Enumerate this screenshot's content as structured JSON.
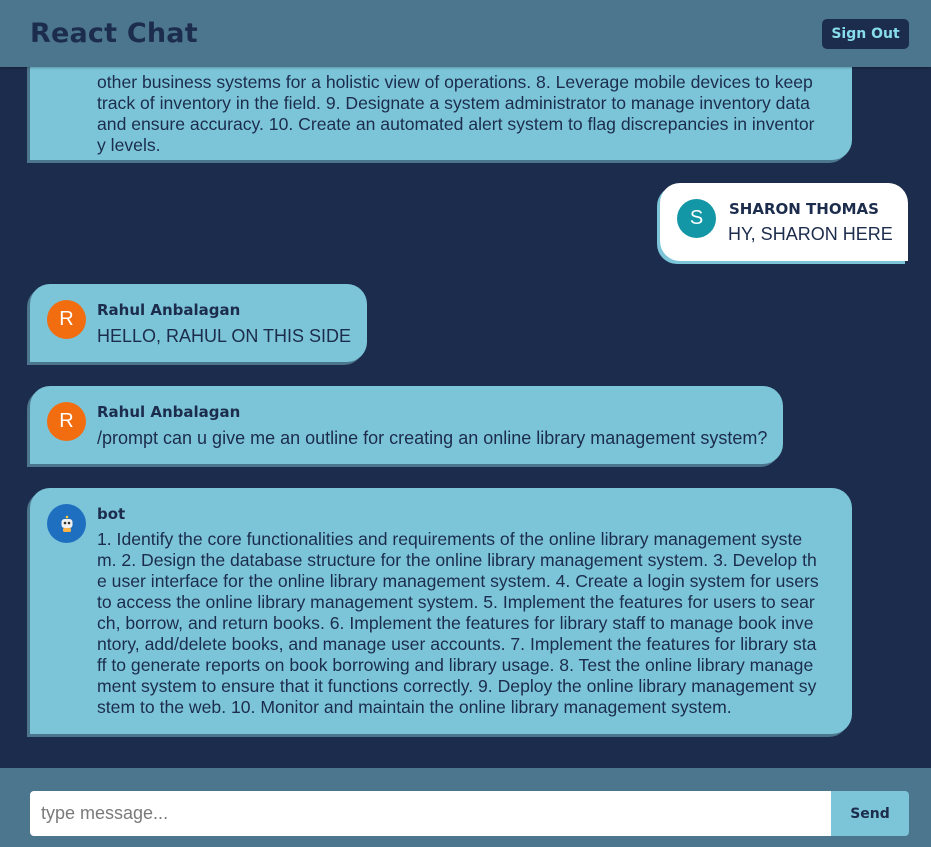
{
  "header": {
    "title": "React Chat",
    "sign_out_label": "Sign Out"
  },
  "messages": [
    {
      "type": "received",
      "sender": "",
      "lines": [
        "other business systems for a holistic view of operations. 8. Leverage mobile devices to keep",
        "track of inventory in the field. 9. Designate a system administrator to manage inventory data",
        "and ensure accuracy. 10. Create an automated alert system to flag discrepancies in inventor",
        "y levels."
      ]
    },
    {
      "type": "sent",
      "sender": "SHARON THOMAS",
      "avatar": "S",
      "avatar_color": "#1397a6",
      "text": "HY, SHARON HERE"
    },
    {
      "type": "received",
      "sender": "Rahul Anbalagan",
      "avatar": "R",
      "avatar_color": "#f26d0f",
      "text": "HELLO, RAHUL ON THIS SIDE"
    },
    {
      "type": "received",
      "sender": "Rahul Anbalagan",
      "avatar": "R",
      "avatar_color": "#f26d0f",
      "text": "/prompt can u give me an outline for creating an online library management system?"
    },
    {
      "type": "received",
      "sender": "bot",
      "avatar_icon": "robot-icon",
      "avatar_color": "#1e6fc0",
      "lines": [
        "1. Identify the core functionalities and requirements of the online library management syste",
        "m. 2. Design the database structure for the online library management system. 3. Develop th",
        "e user interface for the online library management system. 4. Create a login system for users",
        "to access the online library management system. 5. Implement the features for users to sear",
        "ch, borrow, and return books. 6. Implement the features for library staff to manage book inve",
        "ntory, add/delete books, and manage user accounts. 7. Implement the features for library sta",
        "ff to generate reports on book borrowing and library usage. 8. Test the online library manage",
        "ment system to ensure that it functions correctly. 9. Deploy the online library management sy",
        "stem to the web. 10. Monitor and maintain the online library management system."
      ]
    }
  ],
  "composer": {
    "placeholder": "type message...",
    "value": "",
    "send_label": "Send"
  },
  "colors": {
    "background": "#1c2c4c",
    "header": "#4c768d",
    "bubble_received": "#7cc5d9",
    "bubble_sent": "#ffffff"
  }
}
